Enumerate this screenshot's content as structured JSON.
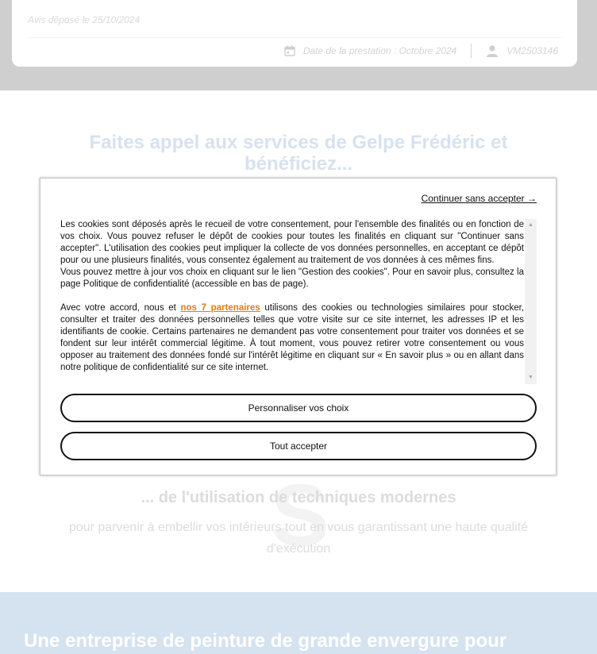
{
  "review": {
    "posted_date": "Avis déposé le 25/10/2024",
    "service_date": "Date de la prestation : Octobre 2024",
    "reviewer_id": "VM2503146"
  },
  "section": {
    "title": "Faites appel aux services de Gelpe Frédéric et bénéficiez...",
    "watermark": "S",
    "subheading": "... de l'utilisation de techniques modernes",
    "subtext": "pour parvenir à embellir vos intérieurs tout en vous garantissant une haute qualité d'exécution"
  },
  "bottom": {
    "title": "Une entreprise de peinture de grande envergure pour"
  },
  "cookie_modal": {
    "continue_link": "Continuer sans accepter →",
    "paragraph1": "Les cookies sont déposés après le recueil de votre consentement, pour l'ensemble des finalités ou en fonction de vos choix. Vous pouvez refuser le dépôt de cookies pour toutes les finalités en cliquant sur \"Continuer sans accepter\". L'utilisation des cookies peut impliquer la collecte de vos données personnelles, en acceptant ce dépôt pour ou une plusieurs finalités, vous consentez également au traitement de vos données à ces mêmes fins.",
    "paragraph2": "Vous pouvez mettre à jour vos choix en cliquant sur le lien \"Gestion des cookies\". Pour en savoir plus, consultez la page Politique de confidentialité (accessible en bas de page).",
    "paragraph3_before": "Avec votre accord, nous et ",
    "partners_link": "nos 7 partenaires",
    "paragraph3_after": " utilisons des cookies ou technologies similaires pour stocker, consulter et traiter des données personnelles telles que votre visite sur ce site internet, les adresses IP et les identifiants de cookie. Certains partenaires ne demandent pas votre consentement pour traiter vos données et se fondent sur leur intérêt commercial légitime. À tout moment, vous pouvez retirer votre consentement ou vous opposer au traitement des données fondé sur l'intérêt légitime en cliquant sur « En savoir plus » ou en allant dans notre politique de confidentialité sur ce site internet.",
    "customize_button": "Personnaliser vos choix",
    "accept_button": "Tout accepter"
  },
  "icons": {
    "calendar": "calendar-icon",
    "user": "user-icon",
    "scroll_up": "▲",
    "scroll_down": "▼"
  },
  "colors": {
    "partners_link": "#e87a0c",
    "section_title": "#d7e2ee",
    "bottom_band": "#d5e2ef"
  }
}
